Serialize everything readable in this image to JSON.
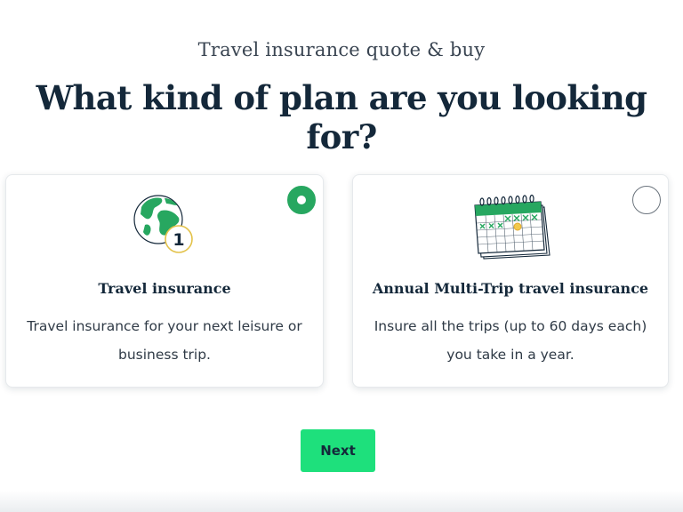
{
  "header": {
    "eyebrow": "Travel insurance quote & buy",
    "headline": "What kind of plan are you looking for?"
  },
  "plans": [
    {
      "icon": "globe-number-one-icon",
      "badge": "1",
      "title": "Travel insurance",
      "description": "Travel insurance for your next leisure or business trip.",
      "selected": true
    },
    {
      "icon": "calendar-icon",
      "title": "Annual Multi-Trip travel insurance",
      "description": "Insure all the trips (up to 60 days each) you take in a year.",
      "selected": false
    }
  ],
  "actions": {
    "next_label": "Next"
  },
  "colors": {
    "accent": "#1ee07c",
    "selected_radio": "#27a760",
    "text_dark": "#14283a"
  }
}
